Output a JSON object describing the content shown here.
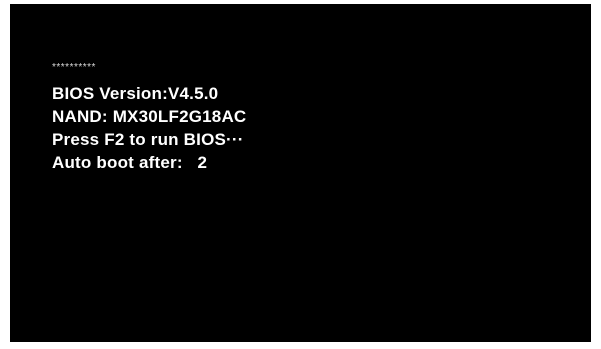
{
  "boot_screen": {
    "stars": "**********",
    "bios_version": "BIOS Version:V4.5.0",
    "nand": "NAND: MX30LF2G18AC",
    "prompt": "Press F2 to run BIOS···",
    "auto_boot": "Auto boot after:   2"
  },
  "colors": {
    "background": "#000000",
    "text": "#ffffff"
  }
}
